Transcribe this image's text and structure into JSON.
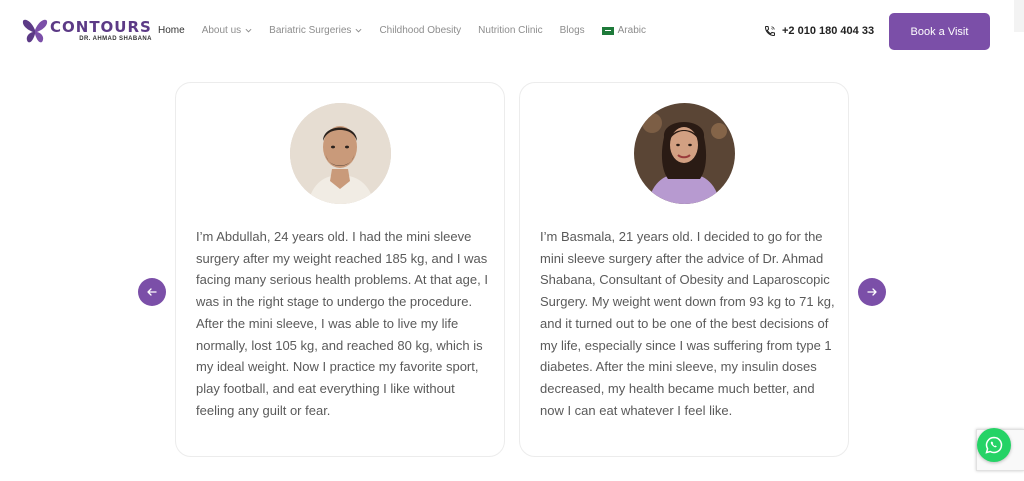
{
  "brand": {
    "name": "CONTOURS",
    "subtitle": "DR. AHMAD SHABANA",
    "color": "#7b4fa8"
  },
  "nav": {
    "items": [
      {
        "label": "Home",
        "active": true,
        "dropdown": false
      },
      {
        "label": "About us",
        "active": false,
        "dropdown": true
      },
      {
        "label": "Bariatric Surgeries",
        "active": false,
        "dropdown": true
      },
      {
        "label": "Childhood Obesity",
        "active": false,
        "dropdown": false
      },
      {
        "label": "Nutrition Clinic",
        "active": false,
        "dropdown": false
      },
      {
        "label": "Blogs",
        "active": false,
        "dropdown": false
      },
      {
        "label": "Arabic",
        "active": false,
        "dropdown": false,
        "icon": "saudi-flag-icon"
      }
    ]
  },
  "header": {
    "phone": "+2 010 180 404 33",
    "phone_icon": "phone-icon",
    "book_label": "Book a Visit"
  },
  "testimonials": [
    {
      "avatar": "man-portrait",
      "text": "I’m Abdullah, 24 years old. I had the mini sleeve surgery after my weight reached 185 kg, and I was facing many serious health problems. At that age, I was in the right stage to undergo the procedure. After the mini sleeve, I was able to live my life normally, lost 105 kg, and reached 80 kg, which is my ideal weight. Now I practice my favorite sport, play football, and eat everything I like without feeling any guilt or fear."
    },
    {
      "avatar": "woman-portrait",
      "text": "I’m Basmala, 21 years old. I decided to go for the mini sleeve surgery after the advice of Dr. Ahmad Shabana, Consultant of Obesity and Laparoscopic Surgery. My weight went down from 93 kg to 71 kg, and it turned out to be one of the best decisions of my life, especially since I was suffering from type 1 diabetes. After the mini sleeve, my insulin doses decreased, my health became much better, and now I can eat whatever I feel like."
    }
  ],
  "carousel": {
    "prev_icon": "arrow-left-icon",
    "next_icon": "arrow-right-icon"
  },
  "floating": {
    "whatsapp_icon": "whatsapp-icon",
    "whatsapp_color": "#25d366"
  }
}
